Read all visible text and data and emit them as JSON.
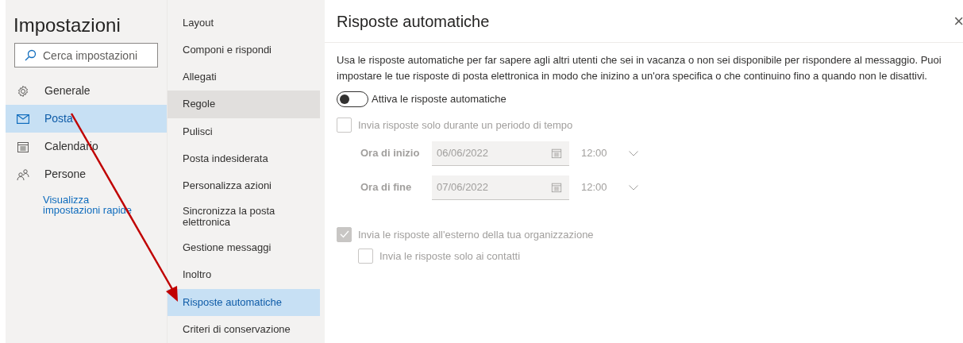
{
  "sidebar": {
    "title": "Impostazioni",
    "search": {
      "placeholder": "Cerca impostazioni"
    },
    "items": [
      {
        "label": "Generale",
        "selected": false
      },
      {
        "label": "Posta",
        "selected": true
      },
      {
        "label": "Calendario",
        "selected": false
      },
      {
        "label": "Persone",
        "selected": false
      }
    ],
    "link": "Visualizza impostazioni rapide"
  },
  "submenu": {
    "items": [
      {
        "label": "Layout",
        "selected": false,
        "hovered": false
      },
      {
        "label": "Componi e rispondi",
        "selected": false,
        "hovered": false
      },
      {
        "label": "Allegati",
        "selected": false,
        "hovered": false
      },
      {
        "label": "Regole",
        "selected": false,
        "hovered": true
      },
      {
        "label": "Pulisci",
        "selected": false,
        "hovered": false
      },
      {
        "label": "Posta indesiderata",
        "selected": false,
        "hovered": false
      },
      {
        "label": "Personalizza azioni",
        "selected": false,
        "hovered": false
      },
      {
        "label": "Sincronizza la posta elettronica",
        "selected": false,
        "hovered": false
      },
      {
        "label": "Gestione messaggi",
        "selected": false,
        "hovered": false
      },
      {
        "label": "Inoltro",
        "selected": false,
        "hovered": false
      },
      {
        "label": "Risposte automatiche",
        "selected": true,
        "hovered": false
      },
      {
        "label": "Criteri di conservazione",
        "selected": false,
        "hovered": false
      }
    ]
  },
  "panel": {
    "title": "Risposte automatiche",
    "close": "×",
    "description": "Usa le risposte automatiche per far sapere agli altri utenti che sei in vacanza o non sei disponibile per rispondere al messaggio. Puoi impostare le tue risposte di posta elettronica in modo che inizino a un'ora specifica o che continuino fino a quando non le disattivi.",
    "toggle": {
      "label": "Attiva le risposte automatiche",
      "on": false
    },
    "period": {
      "label": "Invia risposte solo durante un periodo di tempo",
      "checked": false,
      "disabled": true
    },
    "times": [
      {
        "label": "Ora di inizio",
        "date": "06/06/2022",
        "time": "12:00"
      },
      {
        "label": "Ora di fine",
        "date": "07/06/2022",
        "time": "12:00"
      }
    ],
    "external": {
      "label": "Invia le risposte all'esterno della tua organizzazione",
      "checked": true,
      "disabled": true
    },
    "contacts_only": {
      "label": "Invia le risposte solo ai contatti",
      "checked": false,
      "disabled": true
    }
  }
}
